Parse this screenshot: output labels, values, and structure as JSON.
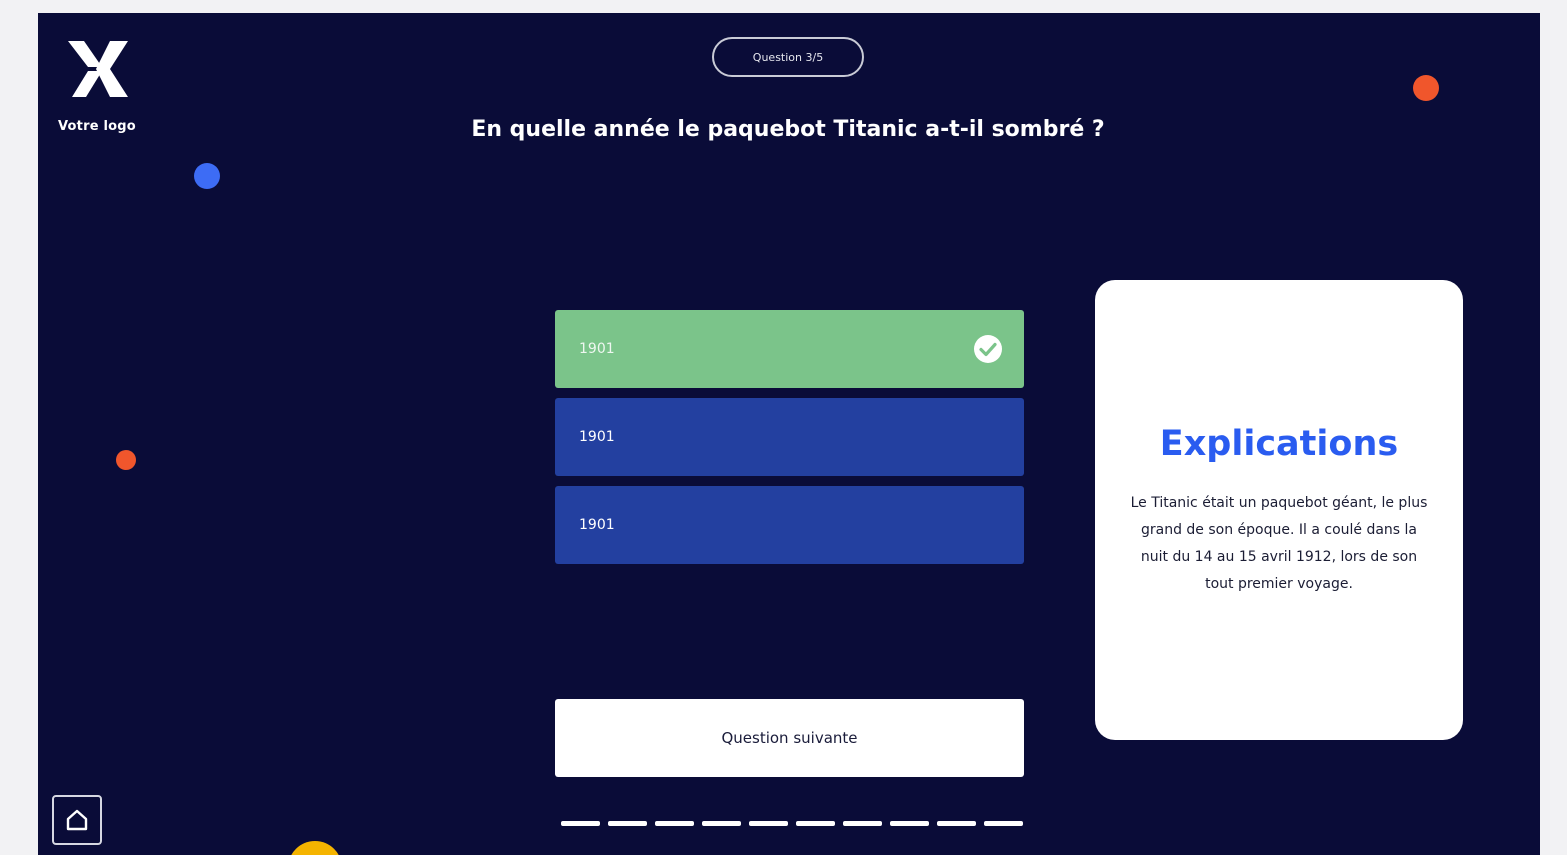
{
  "logo": {
    "text": "Votre logo",
    "icon": "x-logo-icon"
  },
  "quiz": {
    "counter": "Question 3/5",
    "question": "En quelle année le paquebot Titanic a-t-il sombré ?",
    "answers": [
      {
        "label": "1901",
        "state": "correct"
      },
      {
        "label": "1901",
        "state": "default"
      },
      {
        "label": "1901",
        "state": "default"
      }
    ],
    "next_label": "Question suivante",
    "progress_segments": 10
  },
  "explanation": {
    "title": "Explications",
    "body": "Le Titanic était un paquebot géant, le plus grand de son époque. Il a coulé dans la nuit du 14 au 15 avril 1912, lors de son tout premier voyage."
  },
  "colors": {
    "background": "#0a0c38",
    "correct": "#7bc48a",
    "answer": "#2340a0",
    "accent_title": "#2a5cf0",
    "dot_blue": "#3d6cf5",
    "dot_orange": "#f0562c",
    "dot_yellow": "#f5b400"
  },
  "icons": {
    "home": "home-icon",
    "check": "check-circle-icon"
  }
}
